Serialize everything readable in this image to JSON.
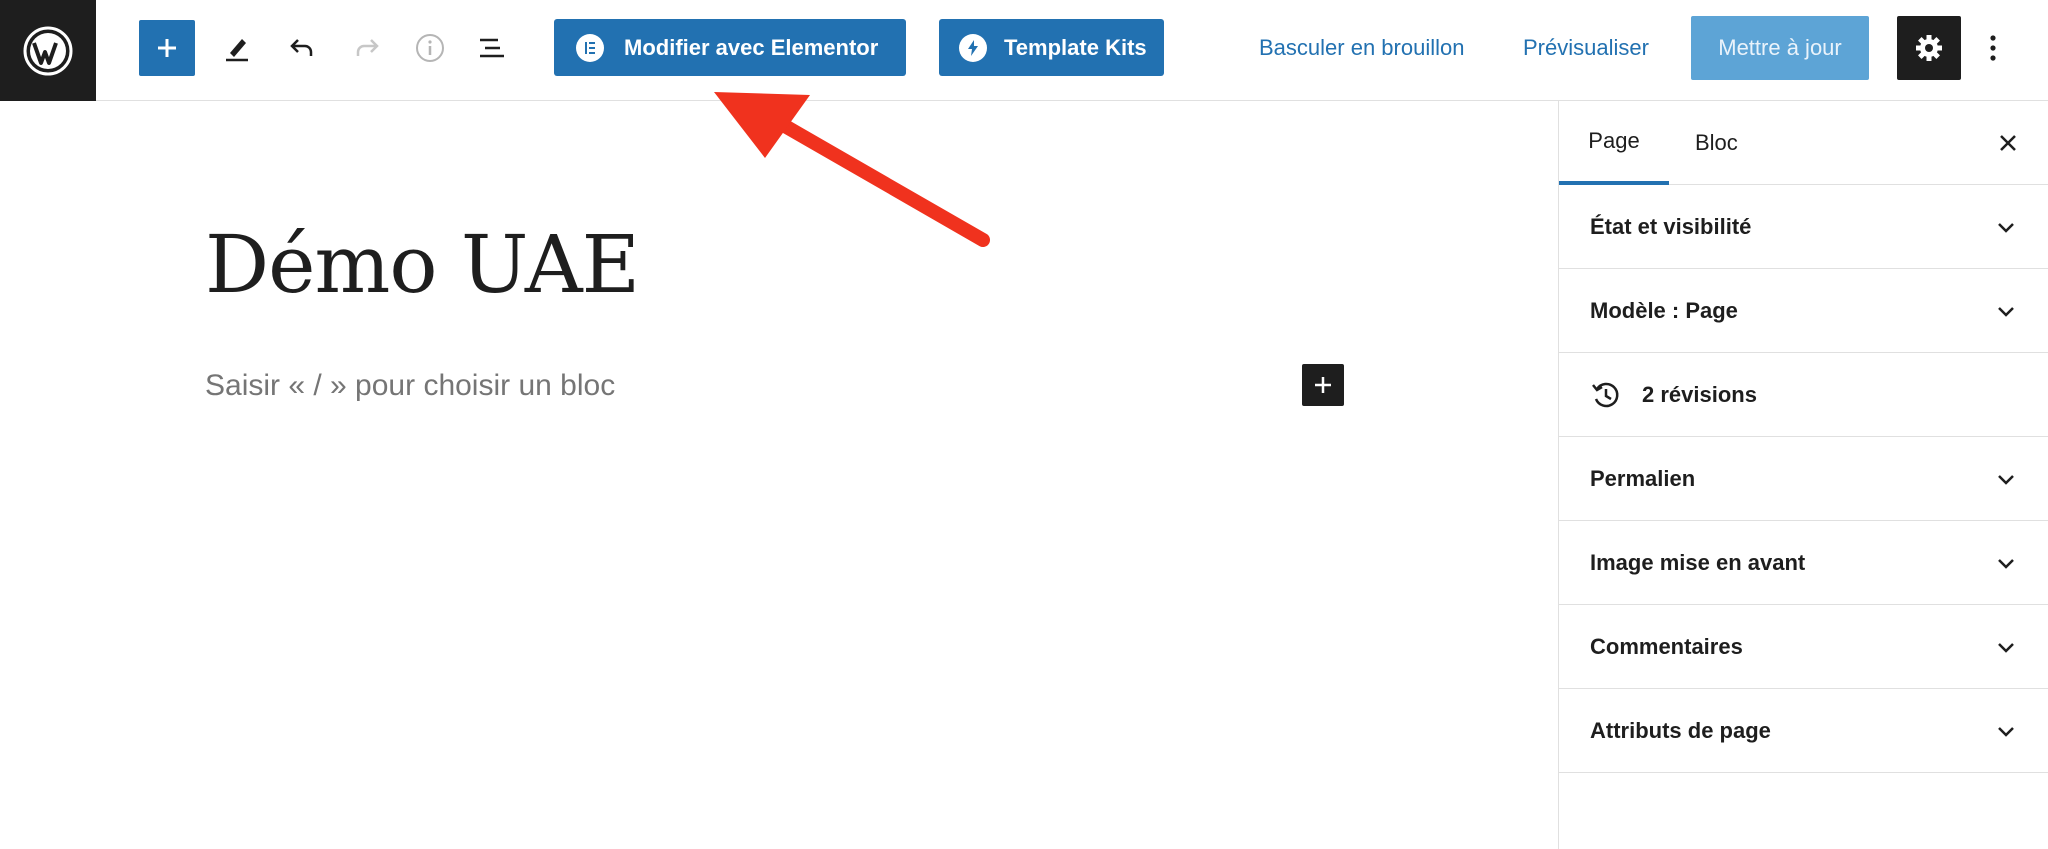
{
  "toolbar": {
    "elementor_label": "Modifier avec Elementor",
    "template_kits_label": "Template Kits",
    "draft_label": "Basculer en brouillon",
    "preview_label": "Prévisualiser",
    "update_label": "Mettre à jour"
  },
  "editor": {
    "title": "Démo UAE",
    "placeholder": "Saisir « / » pour choisir un bloc"
  },
  "sidebar": {
    "tabs": [
      {
        "label": "Page",
        "active": true
      },
      {
        "label": "Bloc",
        "active": false
      }
    ],
    "panels": [
      {
        "label": "État et visibilité",
        "icon": "chevron-down-icon"
      },
      {
        "label": "Modèle : Page",
        "icon": "chevron-down-icon"
      },
      {
        "label": "2 révisions",
        "icon": "history-icon"
      },
      {
        "label": "Permalien",
        "icon": "chevron-down-icon"
      },
      {
        "label": "Image mise en avant",
        "icon": "chevron-down-icon"
      },
      {
        "label": "Commentaires",
        "icon": "chevron-down-icon"
      },
      {
        "label": "Attributs de page",
        "icon": "chevron-down-icon"
      }
    ]
  },
  "colors": {
    "accent": "#2271b1",
    "annotation_arrow": "#f0321e",
    "dark": "#1e1e1e"
  }
}
